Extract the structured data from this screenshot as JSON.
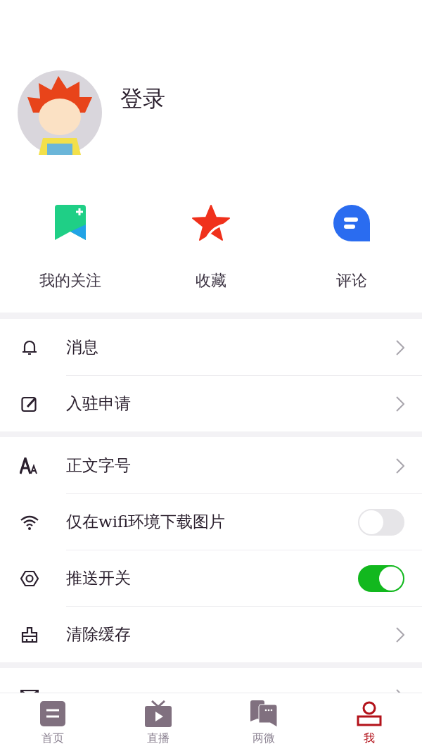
{
  "profile": {
    "login_label": "登录"
  },
  "quick_links": [
    {
      "label": "我的关注"
    },
    {
      "label": "收藏"
    },
    {
      "label": "评论"
    }
  ],
  "menu_groups": [
    {
      "items": [
        {
          "kind": "link",
          "label": "消息"
        },
        {
          "kind": "link",
          "label": "入驻申请"
        }
      ]
    },
    {
      "items": [
        {
          "kind": "link",
          "label": "正文字号"
        },
        {
          "kind": "toggle",
          "label": "仅在wifi环境下载图片",
          "on": false
        },
        {
          "kind": "toggle",
          "label": "推送开关",
          "on": true
        },
        {
          "kind": "link",
          "label": "清除缓存"
        }
      ]
    },
    {
      "items": [
        {
          "kind": "link"
        }
      ]
    }
  ],
  "tab_bar": [
    {
      "label": "首页",
      "selected": false
    },
    {
      "label": "直播",
      "selected": false
    },
    {
      "label": "两微",
      "selected": false
    },
    {
      "label": "我",
      "selected": true
    }
  ]
}
